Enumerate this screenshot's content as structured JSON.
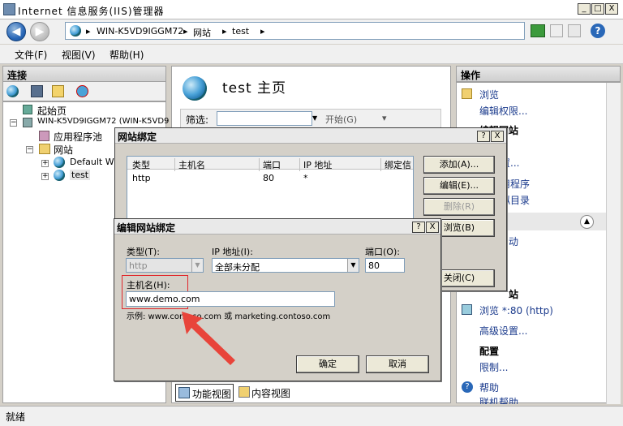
{
  "window": {
    "title": "Internet 信息服务(IIS)管理器",
    "min": "_",
    "max": "□",
    "close": "X"
  },
  "address": {
    "segments": [
      "WIN-K5VD9IGGM72",
      "网站",
      "test"
    ],
    "sep": "▸",
    "back": "◀",
    "forward": "▶",
    "help": "?"
  },
  "menu": [
    "文件(F)",
    "视图(V)",
    "帮助(H)"
  ],
  "connections": {
    "header": "连接",
    "tree": [
      "起始页",
      "WIN-K5VD9IGGM72 (WIN-K5VD9",
      "应用程序池",
      "网站",
      "Default W",
      "test"
    ]
  },
  "center": {
    "title": "test 主页",
    "filter_label": "筛选:",
    "start_label": "开始(G)",
    "feature_view": "功能视图",
    "content_view": "内容视图"
  },
  "actions": {
    "header": "操作",
    "items": [
      "浏览",
      "编辑权限...",
      "编辑网站",
      "置...",
      "用程序",
      "拟目录",
      "动",
      "站",
      "浏览 *:80 (http)",
      "高级设置...",
      "配置",
      "限制...",
      "帮助",
      "联机帮助"
    ]
  },
  "bindings_dialog": {
    "title": "网站绑定",
    "help": "?",
    "close": "X",
    "columns": [
      "类型",
      "主机名",
      "端口",
      "IP 地址",
      "绑定信"
    ],
    "rows": [
      {
        "type": "http",
        "host": "",
        "port": "80",
        "ip": "*",
        "info": ""
      }
    ],
    "buttons": {
      "add": "添加(A)...",
      "edit": "编辑(E)...",
      "remove": "删除(R)",
      "browse": "浏览(B)",
      "close": "关闭(C)"
    }
  },
  "edit_dialog": {
    "title": "编辑网站绑定",
    "help": "?",
    "close": "X",
    "type_label": "类型(T):",
    "type_value": "http",
    "ip_label": "IP 地址(I):",
    "ip_value": "全部未分配",
    "port_label": "端口(O):",
    "port_value": "80",
    "host_label": "主机名(H):",
    "host_value": "www.demo.com",
    "example": "示例: www.contoso.com 或 marketing.contoso.com",
    "ok": "确定",
    "cancel": "取消"
  },
  "status": {
    "text": "就绪"
  },
  "colors": {
    "highlight_box": "#e0262b",
    "arrow": "#e8443a"
  }
}
